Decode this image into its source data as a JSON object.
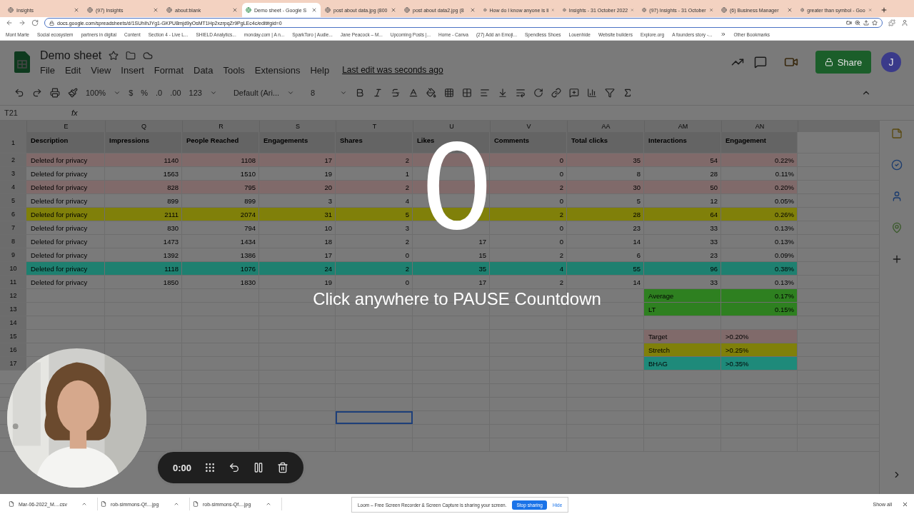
{
  "browser": {
    "tabs": [
      {
        "title": "Insights",
        "selected": false
      },
      {
        "title": "(97) Insights",
        "selected": false
      },
      {
        "title": "about:blank",
        "selected": false
      },
      {
        "title": "Demo sheet - Google S",
        "selected": true
      },
      {
        "title": "post about data.jpg (800",
        "selected": false
      },
      {
        "title": "post about data2.jpg (8",
        "selected": false
      },
      {
        "title": "How do I know anyone is li",
        "selected": false
      },
      {
        "title": "Insights - 31 October 2022",
        "selected": false
      },
      {
        "title": "(97) Insights - 31 October",
        "selected": false
      },
      {
        "title": "(6) Business Manager",
        "selected": false
      },
      {
        "title": "greater than symbol - Goo",
        "selected": false
      }
    ],
    "url": "docs.google.com/spreadsheets/d/1SUhIhJYg1-GKPU8mjd9yOsMT1Hp2xzrpqZr9PgLEc4c/edit#gid=0",
    "bookmarks": [
      "Mont Marte",
      "Social ecosystem",
      "partners in digital",
      "Content",
      "Section 4 - Live L...",
      "SHIELD Analytics...",
      "monday.com | A n...",
      "SparkToro | Audie...",
      "Jane Peacock – M...",
      "Upcoming Posts |...",
      "Home - Canva",
      "(27) Add an Emoji...",
      "Spendless Shoes",
      "Louenhide",
      "Website builders",
      "Explore.org",
      "A founders story -..."
    ],
    "other_bookmarks": "Other Bookmarks"
  },
  "sheet": {
    "title": "Demo sheet",
    "menus": [
      "File",
      "Edit",
      "View",
      "Insert",
      "Format",
      "Data",
      "Tools",
      "Extensions",
      "Help"
    ],
    "last_edit": "Last edit was seconds ago",
    "share": "Share",
    "avatar": "J",
    "toolbar": {
      "zoom": "100%",
      "currency": "$",
      "percent": "%",
      "decrease_decimals": ".0",
      "increase_decimals": ".00",
      "number_format": "123",
      "font": "Default (Ari...",
      "font_size": "8"
    },
    "name_box": "T21",
    "formula_label": "fx",
    "columns": [
      "E",
      "Q",
      "R",
      "S",
      "T",
      "U",
      "V",
      "AA",
      "AM",
      "AN"
    ],
    "header_row": {
      "number": "1",
      "cells": [
        "Description",
        "Impressions",
        "People Reached",
        "Engagements",
        "Shares",
        "Likes",
        "Comments",
        "Total clicks",
        "Interactions",
        "Engagement"
      ]
    },
    "rows": [
      {
        "number": "2",
        "color": "#806a6a",
        "cells": [
          "Deleted for privacy",
          "1140",
          "1108",
          "17",
          "2",
          null,
          "0",
          "35",
          "54",
          "0.22%"
        ]
      },
      {
        "number": "3",
        "cells": [
          "Deleted for privacy",
          "1563",
          "1510",
          "19",
          "1",
          null,
          "0",
          "8",
          "28",
          "0.11%"
        ]
      },
      {
        "number": "4",
        "color": "#806a6a",
        "cells": [
          "Deleted for privacy",
          "828",
          "795",
          "20",
          "2",
          null,
          "2",
          "30",
          "50",
          "0.20%"
        ]
      },
      {
        "number": "5",
        "cells": [
          "Deleted for privacy",
          "899",
          "899",
          "3",
          "4",
          null,
          "0",
          "5",
          "12",
          "0.05%"
        ]
      },
      {
        "number": "6",
        "color": "#80800a",
        "cells": [
          "Deleted for privacy",
          "2111",
          "2074",
          "31",
          "5",
          null,
          "2",
          "28",
          "64",
          "0.26%"
        ]
      },
      {
        "number": "7",
        "cells": [
          "Deleted for privacy",
          "830",
          "794",
          "10",
          "3",
          null,
          "0",
          "23",
          "33",
          "0.13%"
        ]
      },
      {
        "number": "8",
        "cells": [
          "Deleted for privacy",
          "1473",
          "1434",
          "18",
          "2",
          "17",
          "0",
          "14",
          "33",
          "0.13%"
        ]
      },
      {
        "number": "9",
        "cells": [
          "Deleted for privacy",
          "1392",
          "1386",
          "17",
          "0",
          "15",
          "2",
          "6",
          "23",
          "0.09%"
        ]
      },
      {
        "number": "10",
        "color": "#1e8070",
        "cells": [
          "Deleted for privacy",
          "1118",
          "1076",
          "24",
          "2",
          "35",
          "4",
          "55",
          "96",
          "0.38%"
        ]
      },
      {
        "number": "11",
        "cells": [
          "Deleted for privacy",
          "1850",
          "1830",
          "19",
          "0",
          "17",
          "2",
          "14",
          "33",
          "0.13%"
        ]
      }
    ],
    "summary_rows": [
      {
        "number": "12",
        "label": "Average",
        "value": "0.17%",
        "color": "#2e8020"
      },
      {
        "number": "13",
        "label": "LT",
        "value": "0.15%",
        "color": "#2e8020"
      },
      {
        "number": "14"
      },
      {
        "number": "15",
        "label": "Target",
        "value": ">0.20%",
        "color": "#806a6a"
      },
      {
        "number": "16",
        "label": "Stretch",
        "value": ">0.25%",
        "color": "#80800a"
      },
      {
        "number": "17",
        "label": "BHAG",
        "value": ">0.35%",
        "color": "#1e8a7a"
      }
    ],
    "blank_rows": [
      {
        "selected": false
      },
      {
        "selected": false
      },
      {
        "selected": false
      },
      {
        "selected": true
      },
      {
        "selected": false
      },
      {
        "selected": false
      }
    ]
  },
  "countdown": {
    "number": "0",
    "message": "Click anywhere to PAUSE Countdown"
  },
  "recorder": {
    "time": "0:00"
  },
  "downloads": {
    "files": [
      "Mar-06-2022_M....csv",
      "rob-simmons-Qf....jpg",
      "rob-simmons-Qf....jpg"
    ],
    "show_all": "Show all"
  },
  "sharing_notice": {
    "message": "Loom – Free Screen Recorder & Screen Capture is sharing your screen.",
    "stop": "Stop sharing",
    "hide": "Hide"
  }
}
